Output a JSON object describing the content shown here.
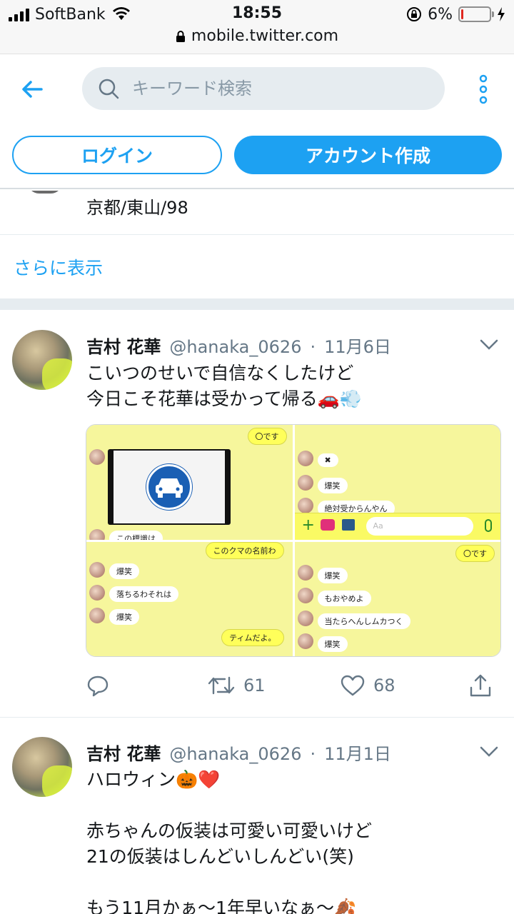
{
  "status_bar": {
    "carrier": "SoftBank",
    "time": "18:55",
    "battery_percent": "6%",
    "battery_level": 0.06,
    "url": "mobile.twitter.com"
  },
  "header": {
    "search_placeholder": "キーワード検索",
    "login_label": "ログイン",
    "signup_label": "アカウント作成"
  },
  "prev_user": {
    "bio": "京都/東山/98"
  },
  "show_more_label": "さらに表示",
  "tweets": [
    {
      "name": "吉村 花華",
      "handle": "@hanaka_0626",
      "dot": "·",
      "date": "11月6日",
      "text": "こいつのせいで自信なくしたけど\n今日こそ花華は受かって帰る🚗💨",
      "retweets": "61",
      "likes": "68",
      "media": {
        "panel1": {
          "me_top": "〇です",
          "bottom": "この標識は"
        },
        "panel2": {
          "m1": "✖",
          "m2": "爆笑",
          "m3": "絶対受からんやん",
          "input_placeholder": "Aa"
        },
        "panel3": {
          "me_top": "このクマの名前わ",
          "m1": "爆笑",
          "m2": "落ちるわそれは",
          "m3": "爆笑",
          "me_bottom": "ティムだよ。"
        },
        "panel4": {
          "me_top": "〇です",
          "m1": "爆笑",
          "m2": "もおやめよ",
          "m3": "当たらへんしムカつく",
          "m4": "爆笑"
        }
      }
    },
    {
      "name": "吉村 花華",
      "handle": "@hanaka_0626",
      "dot": "·",
      "date": "11月1日",
      "text": "ハロウィン🎃❤️\n\n赤ちゃんの仮装は可愛い可愛いけど\n21の仮装はしんどいしんどい(笑)\n\nもう11月かぁ〜1年早いなぁ〜🍂"
    }
  ],
  "colors": {
    "accent": "#1da1f2",
    "muted": "#657786",
    "chat_bg": "#f6f69c"
  }
}
